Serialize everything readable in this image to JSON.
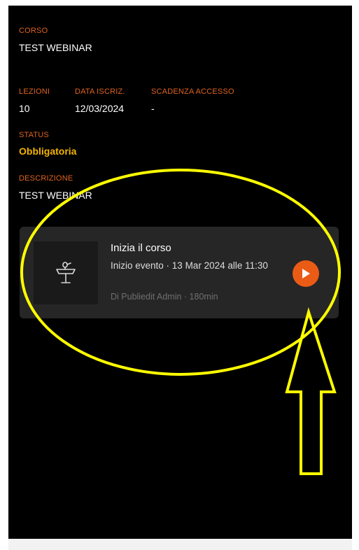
{
  "course": {
    "label": "CORSO",
    "value": "TEST WEBINAR"
  },
  "stats": {
    "lessons": {
      "label": "LEZIONI",
      "value": "10"
    },
    "enroll_date": {
      "label": "DATA ISCRIZ.",
      "value": "12/03/2024"
    },
    "access_expiry": {
      "label": "SCADENZA ACCESSO",
      "value": "-"
    }
  },
  "status": {
    "label": "STATUS",
    "value": "Obbligatoria"
  },
  "description": {
    "label": "DESCRIZIONE",
    "value": "TEST WEBINAR"
  },
  "lesson_card": {
    "title": "Inizia il corso",
    "subtitle": "Inizio evento · 13 Mar 2024 alle 11:30",
    "meta": "Di Publiedit Admin · 180min",
    "thumbnail_icon": "podium-icon",
    "action_icon": "play-icon"
  },
  "annotations": {
    "highlight_color": "#ffff00"
  },
  "colors": {
    "label": "#e0641f",
    "status": "#f5b400",
    "accent": "#ea5b16",
    "card_bg": "#262626",
    "screen_bg": "#000000"
  }
}
